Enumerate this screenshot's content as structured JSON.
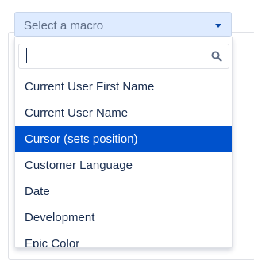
{
  "macro_select": {
    "placeholder": "Select a macro",
    "search": {
      "value": "",
      "placeholder": ""
    },
    "options": [
      {
        "label": "Current User First Name",
        "selected": false
      },
      {
        "label": "Current User Name",
        "selected": false
      },
      {
        "label": "Cursor (sets position)",
        "selected": true
      },
      {
        "label": "Customer Language",
        "selected": false
      },
      {
        "label": "Date",
        "selected": false
      },
      {
        "label": "Development",
        "selected": false
      },
      {
        "label": "Epic Color",
        "selected": false
      }
    ]
  },
  "icons": {
    "search": "search-icon",
    "dropdown": "chevron-down-icon"
  },
  "colors": {
    "trigger_background": "#deebff",
    "selected_background": "#0052cc",
    "selected_text": "#ffffff",
    "text": "#172b4d",
    "placeholder_text": "#5e6c84"
  }
}
